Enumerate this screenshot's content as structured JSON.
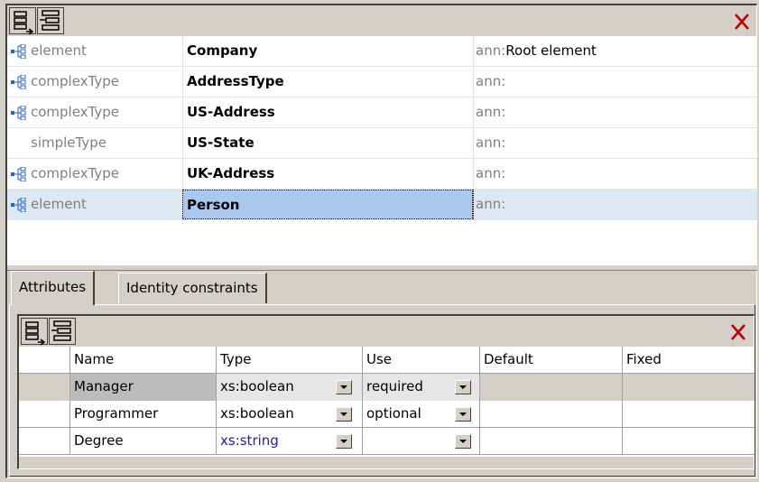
{
  "schema_components": [
    {
      "kind": "element",
      "name": "Company",
      "ann_prefix": "ann:",
      "ann_value": "Root element",
      "has_icon": true,
      "selected": false
    },
    {
      "kind": "complexType",
      "name": "AddressType",
      "ann_prefix": "ann:",
      "ann_value": "",
      "has_icon": true,
      "selected": false
    },
    {
      "kind": "complexType",
      "name": "US-Address",
      "ann_prefix": "ann:",
      "ann_value": "",
      "has_icon": true,
      "selected": false
    },
    {
      "kind": "simpleType",
      "name": "US-State",
      "ann_prefix": "ann:",
      "ann_value": "",
      "has_icon": false,
      "selected": false
    },
    {
      "kind": "complexType",
      "name": "UK-Address",
      "ann_prefix": "ann:",
      "ann_value": "",
      "has_icon": true,
      "selected": false
    },
    {
      "kind": "element",
      "name": "Person",
      "ann_prefix": "ann:",
      "ann_value": "",
      "has_icon": true,
      "selected": true
    }
  ],
  "tabs": [
    {
      "label": "Attributes",
      "active": true
    },
    {
      "label": "Identity constraints",
      "active": false
    }
  ],
  "attributes_table": {
    "headers": [
      "",
      "Name",
      "Type",
      "Use",
      "Default",
      "Fixed"
    ],
    "rows": [
      {
        "name": "Manager",
        "type": "xs:boolean",
        "use": "required",
        "default": "",
        "fixed": "",
        "type_blue": false,
        "selected": true
      },
      {
        "name": "Programmer",
        "type": "xs:boolean",
        "use": "optional",
        "default": "",
        "fixed": "",
        "type_blue": false,
        "selected": false
      },
      {
        "name": "Degree",
        "type": "xs:string",
        "use": "",
        "default": "",
        "fixed": "",
        "type_blue": true,
        "selected": false
      }
    ]
  },
  "icons": {
    "toolbar": [
      "append-icon",
      "insert-icon",
      "delete-icon"
    ],
    "component": "structure-icon"
  },
  "colors": {
    "background": "#d4d0c8",
    "selection": "#a9c9ef",
    "selected_row": "#dde8f2",
    "type_link": "#1a1acc",
    "delete": "#c00000",
    "component_icon": "#2a5fd6"
  }
}
